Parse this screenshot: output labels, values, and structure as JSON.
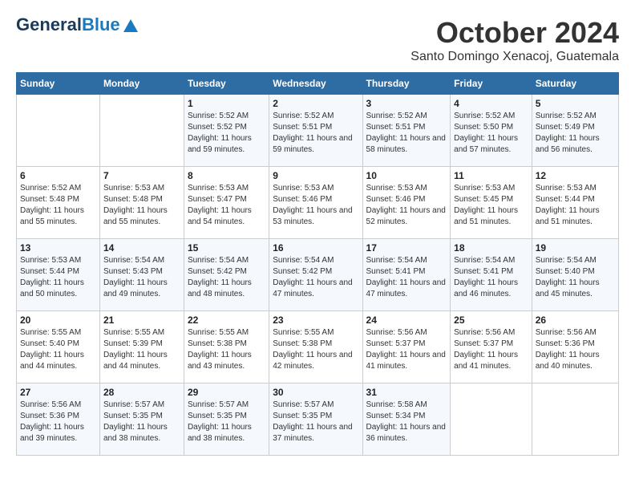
{
  "header": {
    "logo_general": "General",
    "logo_blue": "Blue",
    "month_title": "October 2024",
    "subtitle": "Santo Domingo Xenacoj, Guatemala"
  },
  "days_of_week": [
    "Sunday",
    "Monday",
    "Tuesday",
    "Wednesday",
    "Thursday",
    "Friday",
    "Saturday"
  ],
  "weeks": [
    [
      {
        "day": "",
        "info": ""
      },
      {
        "day": "",
        "info": ""
      },
      {
        "day": "1",
        "info": "Sunrise: 5:52 AM\nSunset: 5:52 PM\nDaylight: 11 hours and 59 minutes."
      },
      {
        "day": "2",
        "info": "Sunrise: 5:52 AM\nSunset: 5:51 PM\nDaylight: 11 hours and 59 minutes."
      },
      {
        "day": "3",
        "info": "Sunrise: 5:52 AM\nSunset: 5:51 PM\nDaylight: 11 hours and 58 minutes."
      },
      {
        "day": "4",
        "info": "Sunrise: 5:52 AM\nSunset: 5:50 PM\nDaylight: 11 hours and 57 minutes."
      },
      {
        "day": "5",
        "info": "Sunrise: 5:52 AM\nSunset: 5:49 PM\nDaylight: 11 hours and 56 minutes."
      }
    ],
    [
      {
        "day": "6",
        "info": "Sunrise: 5:52 AM\nSunset: 5:48 PM\nDaylight: 11 hours and 55 minutes."
      },
      {
        "day": "7",
        "info": "Sunrise: 5:53 AM\nSunset: 5:48 PM\nDaylight: 11 hours and 55 minutes."
      },
      {
        "day": "8",
        "info": "Sunrise: 5:53 AM\nSunset: 5:47 PM\nDaylight: 11 hours and 54 minutes."
      },
      {
        "day": "9",
        "info": "Sunrise: 5:53 AM\nSunset: 5:46 PM\nDaylight: 11 hours and 53 minutes."
      },
      {
        "day": "10",
        "info": "Sunrise: 5:53 AM\nSunset: 5:46 PM\nDaylight: 11 hours and 52 minutes."
      },
      {
        "day": "11",
        "info": "Sunrise: 5:53 AM\nSunset: 5:45 PM\nDaylight: 11 hours and 51 minutes."
      },
      {
        "day": "12",
        "info": "Sunrise: 5:53 AM\nSunset: 5:44 PM\nDaylight: 11 hours and 51 minutes."
      }
    ],
    [
      {
        "day": "13",
        "info": "Sunrise: 5:53 AM\nSunset: 5:44 PM\nDaylight: 11 hours and 50 minutes."
      },
      {
        "day": "14",
        "info": "Sunrise: 5:54 AM\nSunset: 5:43 PM\nDaylight: 11 hours and 49 minutes."
      },
      {
        "day": "15",
        "info": "Sunrise: 5:54 AM\nSunset: 5:42 PM\nDaylight: 11 hours and 48 minutes."
      },
      {
        "day": "16",
        "info": "Sunrise: 5:54 AM\nSunset: 5:42 PM\nDaylight: 11 hours and 47 minutes."
      },
      {
        "day": "17",
        "info": "Sunrise: 5:54 AM\nSunset: 5:41 PM\nDaylight: 11 hours and 47 minutes."
      },
      {
        "day": "18",
        "info": "Sunrise: 5:54 AM\nSunset: 5:41 PM\nDaylight: 11 hours and 46 minutes."
      },
      {
        "day": "19",
        "info": "Sunrise: 5:54 AM\nSunset: 5:40 PM\nDaylight: 11 hours and 45 minutes."
      }
    ],
    [
      {
        "day": "20",
        "info": "Sunrise: 5:55 AM\nSunset: 5:40 PM\nDaylight: 11 hours and 44 minutes."
      },
      {
        "day": "21",
        "info": "Sunrise: 5:55 AM\nSunset: 5:39 PM\nDaylight: 11 hours and 44 minutes."
      },
      {
        "day": "22",
        "info": "Sunrise: 5:55 AM\nSunset: 5:38 PM\nDaylight: 11 hours and 43 minutes."
      },
      {
        "day": "23",
        "info": "Sunrise: 5:55 AM\nSunset: 5:38 PM\nDaylight: 11 hours and 42 minutes."
      },
      {
        "day": "24",
        "info": "Sunrise: 5:56 AM\nSunset: 5:37 PM\nDaylight: 11 hours and 41 minutes."
      },
      {
        "day": "25",
        "info": "Sunrise: 5:56 AM\nSunset: 5:37 PM\nDaylight: 11 hours and 41 minutes."
      },
      {
        "day": "26",
        "info": "Sunrise: 5:56 AM\nSunset: 5:36 PM\nDaylight: 11 hours and 40 minutes."
      }
    ],
    [
      {
        "day": "27",
        "info": "Sunrise: 5:56 AM\nSunset: 5:36 PM\nDaylight: 11 hours and 39 minutes."
      },
      {
        "day": "28",
        "info": "Sunrise: 5:57 AM\nSunset: 5:35 PM\nDaylight: 11 hours and 38 minutes."
      },
      {
        "day": "29",
        "info": "Sunrise: 5:57 AM\nSunset: 5:35 PM\nDaylight: 11 hours and 38 minutes."
      },
      {
        "day": "30",
        "info": "Sunrise: 5:57 AM\nSunset: 5:35 PM\nDaylight: 11 hours and 37 minutes."
      },
      {
        "day": "31",
        "info": "Sunrise: 5:58 AM\nSunset: 5:34 PM\nDaylight: 11 hours and 36 minutes."
      },
      {
        "day": "",
        "info": ""
      },
      {
        "day": "",
        "info": ""
      }
    ]
  ]
}
